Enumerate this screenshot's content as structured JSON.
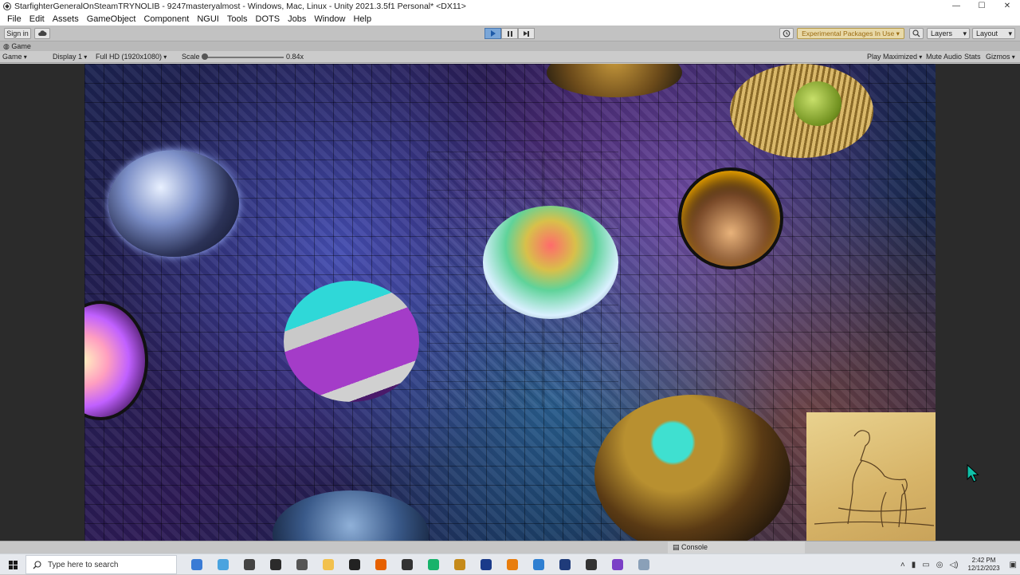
{
  "window": {
    "title": "StarfighterGeneralOnSteamTRYNOLIB - 9247masteryalmost - Windows, Mac, Linux - Unity 2021.3.5f1 Personal* <DX11>",
    "controls": {
      "minimize": "—",
      "maximize": "☐",
      "close": "✕"
    }
  },
  "menu": [
    "File",
    "Edit",
    "Assets",
    "GameObject",
    "Component",
    "NGUI",
    "Tools",
    "DOTS",
    "Jobs",
    "Window",
    "Help"
  ],
  "toolbar": {
    "sign_in": "Sign in",
    "cloud_icon": "cloud-icon",
    "experimental_packages": "Experimental Packages In Use ▾",
    "layers": "Layers",
    "layout": "Layout",
    "history_icon": "history-icon",
    "search_icon": "search-icon"
  },
  "game_view": {
    "tab_label": "Game",
    "mode": "Game",
    "display": "Display 1",
    "resolution": "Full HD (1920x1080)",
    "scale_label": "Scale",
    "scale_value": "0.84x",
    "play_mode": "Play Maximized",
    "mute_audio": "Mute Audio",
    "stats": "Stats",
    "gizmos": "Gizmos",
    "playing": true
  },
  "console": {
    "tab_label": "Console"
  },
  "taskbar": {
    "search_placeholder": "Type here to search",
    "apps": [
      {
        "name": "store-icon",
        "color": "#3a7bd5"
      },
      {
        "name": "files-icon",
        "color": "#4aa3df"
      },
      {
        "name": "unity-hub-icon",
        "color": "#444444"
      },
      {
        "name": "media-icon",
        "color": "#2b2b2b"
      },
      {
        "name": "calculator-icon",
        "color": "#555555"
      },
      {
        "name": "folder-icon",
        "color": "#f2c14e"
      },
      {
        "name": "qr-icon",
        "color": "#222222"
      },
      {
        "name": "firefox-icon",
        "color": "#e66000"
      },
      {
        "name": "app-icon",
        "color": "#333333"
      },
      {
        "name": "game-icon",
        "color": "#18b36b"
      },
      {
        "name": "tool-icon",
        "color": "#c58a1a"
      },
      {
        "name": "headset-icon",
        "color": "#1a3a8a"
      },
      {
        "name": "blender-icon",
        "color": "#e87d0d"
      },
      {
        "name": "browser-icon",
        "color": "#2f7fd1"
      },
      {
        "name": "disc-icon",
        "color": "#1f3b7a"
      },
      {
        "name": "unity-icon",
        "color": "#333333"
      },
      {
        "name": "visual-studio-icon",
        "color": "#7b3fc6"
      },
      {
        "name": "window-icon",
        "color": "#8aa0b8"
      }
    ],
    "time": "2:42 PM",
    "date": "12/12/2023"
  },
  "colors": {
    "play_active": "#7aa6d8",
    "experimental_bg": "#e8d9a8",
    "editor_bg": "#c2c2c2"
  }
}
